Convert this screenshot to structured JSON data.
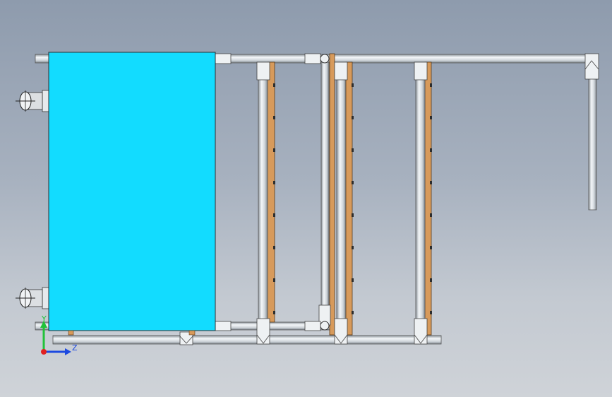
{
  "model": {
    "panel_color": "#12dcff",
    "tube_color": "#d3d9de",
    "wood_color": "#d79a5b",
    "outline_color": "#3a3f44"
  },
  "triad": {
    "y_label": "Y",
    "z_label": "Z",
    "y_color": "#22c23a",
    "z_color": "#1c49e0",
    "x_color": "#e02020"
  }
}
